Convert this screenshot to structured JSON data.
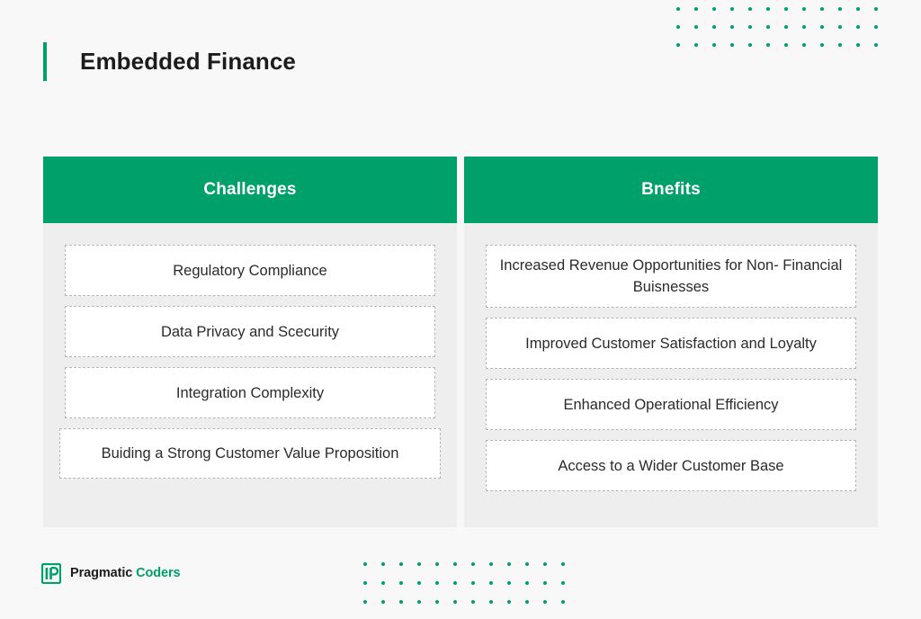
{
  "page": {
    "title": "Embedded Finance",
    "background_color": "#f8f8f8",
    "accent_color": "#00a06b"
  },
  "decor": {
    "top_right_dots": {
      "columns": 12,
      "rows": 3,
      "color": "#00a06b"
    },
    "bottom_dots": {
      "columns": 12,
      "rows": 3,
      "color": "#00a06b"
    }
  },
  "columns": [
    {
      "header": "Challenges",
      "items": [
        "Regulatory Compliance",
        "Data Privacy and Scecurity",
        "Integration Complexity",
        "Buiding a Strong Customer Value Proposition"
      ]
    },
    {
      "header": "Bnefits",
      "items": [
        "Increased Revenue Opportunities for Non- Financial Buisnesses",
        "Improved Customer Satisfaction and Loyalty",
        "Enhanced Operational Efficiency",
        "Access to a Wider Customer Base"
      ]
    }
  ],
  "brand": {
    "mark": "pragmatic-coders-p-logo",
    "name_primary": "Pragmatic",
    "name_accent": "Coders"
  }
}
